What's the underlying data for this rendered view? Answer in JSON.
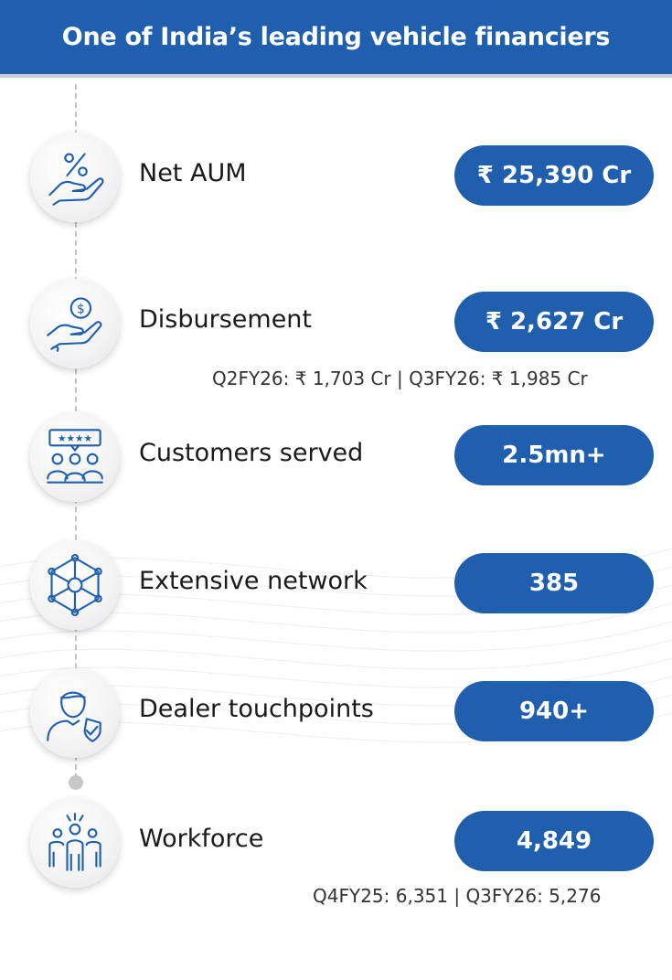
{
  "header": {
    "title": "One of India’s leading vehicle financiers"
  },
  "colors": {
    "brand_blue": "#1f5fae",
    "icon_stroke": "#1f5fae",
    "timeline": "#c4c4c4"
  },
  "metrics": [
    {
      "label": "Net AUM",
      "value": "₹ 25,390 Cr",
      "icon": "percent-hand-icon",
      "note": ""
    },
    {
      "label": "Disbursement",
      "value": "₹ 2,627 Cr",
      "icon": "coin-hand-icon",
      "note": "Q2FY26: ₹ 1,703 Cr | Q3FY26: ₹ 1,985 Cr"
    },
    {
      "label": "Customers served",
      "value": "2.5mn+",
      "icon": "customers-rating-icon",
      "note": ""
    },
    {
      "label": "Extensive network",
      "value": "385",
      "icon": "network-icon",
      "note": ""
    },
    {
      "label": "Dealer touchpoints",
      "value": "940+",
      "icon": "dealer-shield-icon",
      "note": ""
    },
    {
      "label": "Workforce",
      "value": "4,849",
      "icon": "workforce-icon",
      "note": "Q4FY25: 6,351 | Q3FY26: 5,276"
    }
  ]
}
